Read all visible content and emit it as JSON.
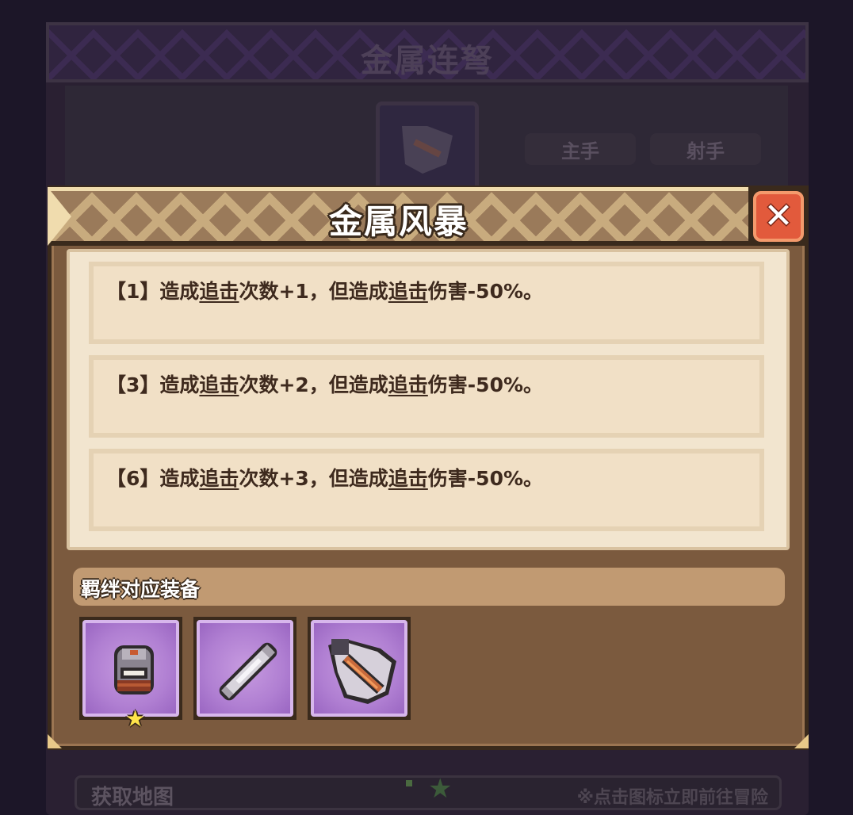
{
  "background_window": {
    "title": "金属连弩",
    "tags": [
      "主手",
      "射手"
    ],
    "footer_label": "获取地图",
    "footer_hint": "※点击图标立即前往冒险"
  },
  "modal": {
    "title": "金属风暴",
    "close_icon": "close-icon",
    "bonuses": [
      {
        "level": "【1】",
        "pre": "造成",
        "kw1": "追击",
        "mid": "次数+1，但造成",
        "kw2": "追击",
        "post": "伤害-50%。"
      },
      {
        "level": "【3】",
        "pre": "造成",
        "kw1": "追击",
        "mid": "次数+2，但造成",
        "kw2": "追击",
        "post": "伤害-50%。"
      },
      {
        "level": "【6】",
        "pre": "造成",
        "kw1": "追击",
        "mid": "次数+3，但造成",
        "kw2": "追击",
        "post": "伤害-50%。"
      }
    ],
    "equipment_section_label": "羁绊对应装备",
    "equipment": [
      {
        "icon": "helmet-icon",
        "starred": true
      },
      {
        "icon": "bolt-cylinder-icon",
        "starred": false
      },
      {
        "icon": "crossbow-icon",
        "starred": false
      }
    ]
  },
  "colors": {
    "accent_purple": "#b07fd2",
    "close_red": "#e25a3c",
    "panel_cream": "#f2e5cf",
    "frame_brown": "#7b5a3e"
  }
}
